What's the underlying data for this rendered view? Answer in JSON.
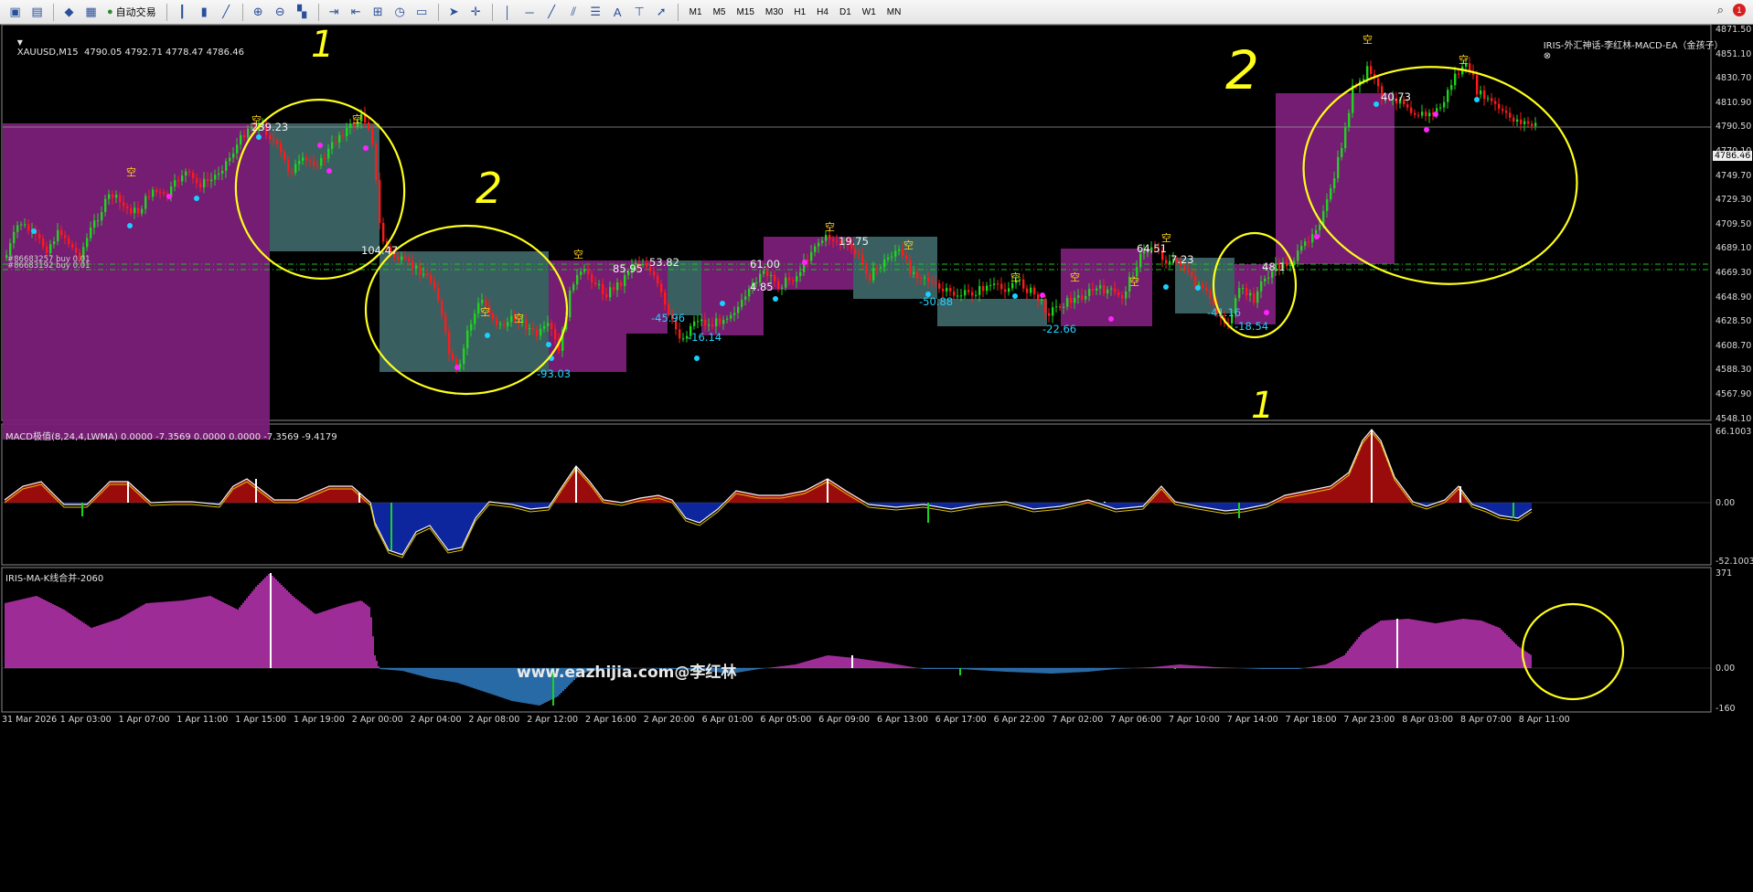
{
  "toolbar": {
    "auto_trading_label": "自动交易",
    "timeframes": [
      "M1",
      "M5",
      "M15",
      "M30",
      "H1",
      "H4",
      "D1",
      "W1",
      "MN"
    ],
    "notification_count": "1"
  },
  "main_chart": {
    "header": "XAUUSD,M15  4790.05 4792.71 4778.47 4786.46",
    "indicator_name": "IRIS-外汇神话-李红林-MACD-EA（金孩子）",
    "current_price": "4786.46",
    "price_axis": [
      "4871.50",
      "4851.10",
      "4830.70",
      "4810.90",
      "4790.50",
      "4770.10",
      "4749.70",
      "4729.30",
      "4709.50",
      "4689.10",
      "4669.30",
      "4648.90",
      "4628.50",
      "4608.70",
      "4588.30",
      "4567.90",
      "4548.10"
    ],
    "order_lines": [
      "#86683257 buy 0.01",
      "#86683192 buy 0.01"
    ],
    "annotations_white": [
      "239.23",
      "104.47",
      "85.95",
      "53.82",
      "61.00",
      "4.85",
      "19.75",
      "64.51",
      "7.23",
      "48.1",
      "40.73"
    ],
    "annotations_cyan": [
      "-93.03",
      "-45.96",
      "-16.14",
      "-50.88",
      "-22.66",
      "-41.16",
      "-18.54"
    ],
    "signal_glyph": "空"
  },
  "macd_pane": {
    "label": "MACD极值(8,24,4,LWMA) 0.0000 -7.3569 0.0000 0.0000 -7.3569 -9.4179",
    "axis": [
      "66.1003",
      "0.00",
      "-52.1003"
    ],
    "watermark": "www.eazhijia.com@李红林"
  },
  "ma_pane": {
    "label": "IRIS-MA-K线合并-2060",
    "axis": [
      "371",
      "0.00",
      "-160"
    ]
  },
  "time_axis": [
    "31 Mar 2026",
    "1 Apr 03:00",
    "1 Apr 07:00",
    "1 Apr 11:00",
    "1 Apr 15:00",
    "1 Apr 19:00",
    "2 Apr 00:00",
    "2 Apr 04:00",
    "2 Apr 08:00",
    "2 Apr 12:00",
    "2 Apr 16:00",
    "2 Apr 20:00",
    "6 Apr 01:00",
    "6 Apr 05:00",
    "6 Apr 09:00",
    "6 Apr 13:00",
    "6 Apr 17:00",
    "6 Apr 22:00",
    "7 Apr 02:00",
    "7 Apr 06:00",
    "7 Apr 10:00",
    "7 Apr 14:00",
    "7 Apr 18:00",
    "7 Apr 23:00",
    "8 Apr 03:00",
    "8 Apr 07:00",
    "8 Apr 11:00"
  ],
  "handwritten": [
    "1",
    "2",
    "2",
    "1"
  ],
  "colors": {
    "bull": "#1fd41f",
    "bear": "#ff1a1a",
    "purple_box": "#7a1f78",
    "teal_box": "#3d6466",
    "macd_pos": "#dd1111",
    "macd_neg": "#1537e0",
    "ma_pos": "#e23fd8",
    "ma_neg": "#3a98ee",
    "pen": "#ffff1a"
  }
}
